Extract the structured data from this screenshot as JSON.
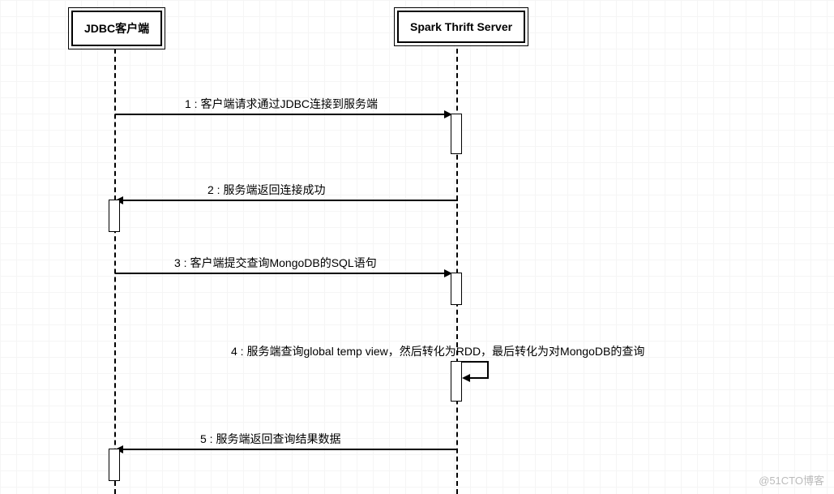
{
  "participants": {
    "client": "JDBC客户端",
    "server": "Spark Thrift Server"
  },
  "messages": {
    "m1": "1 : 客户端请求通过JDBC连接到服务端",
    "m2": "2 : 服务端返回连接成功",
    "m3": "3 : 客户端提交查询MongoDB的SQL语句",
    "m4": "4 : 服务端查询global temp view，然后转化为RDD，最后转化为对MongoDB的查询",
    "m5": "5 : 服务端返回查询结果数据"
  },
  "watermark": "@51CTO博客"
}
